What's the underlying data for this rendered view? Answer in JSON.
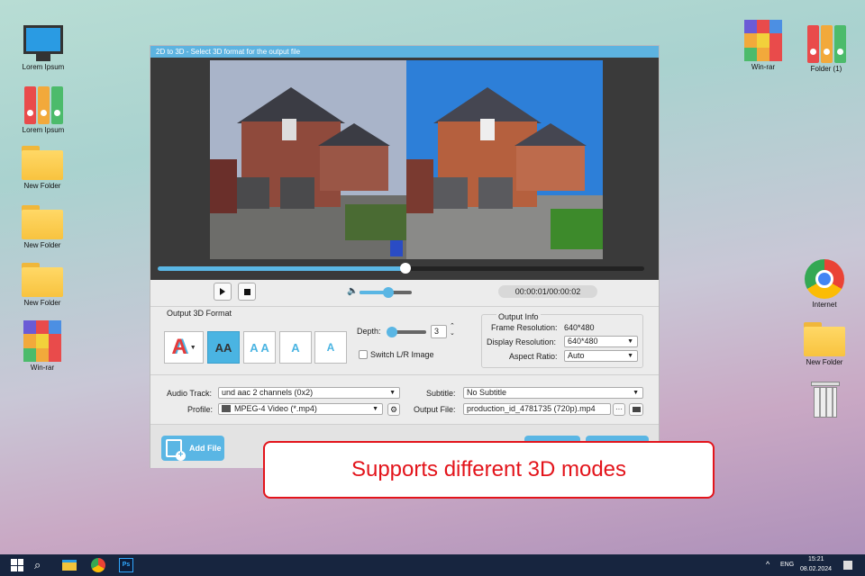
{
  "desktop_left": [
    {
      "label": "Lorem Ipsum",
      "icon": "computer-icon"
    },
    {
      "label": "Lorem Ipsum",
      "icon": "binders-icon"
    },
    {
      "label": "New Folder",
      "icon": "folder-icon"
    },
    {
      "label": "New Folder",
      "icon": "folder-icon"
    },
    {
      "label": "New Folder",
      "icon": "folder-icon"
    },
    {
      "label": "Win-rar",
      "icon": "winrar-icon"
    }
  ],
  "desktop_right": [
    {
      "label": "Win-rar"
    },
    {
      "label": "Folder (1)"
    },
    {
      "label": "Internet"
    },
    {
      "label": "New Folder"
    }
  ],
  "window": {
    "title": "2D to 3D - Select 3D format for the output file"
  },
  "player": {
    "progress": 0.51,
    "volume": 0.55,
    "time": "00:00:01/00:00:02"
  },
  "format": {
    "heading": "Output 3D Format",
    "depth_label": "Depth:",
    "depth_value": "3",
    "switch_label": "Switch L/R Image",
    "modes": [
      "AA",
      "A A",
      "A",
      "A"
    ]
  },
  "output_info": {
    "heading": "Output Info",
    "frame_label": "Frame Resolution:",
    "frame_value": "640*480",
    "display_label": "Display Resolution:",
    "display_value": "640*480",
    "aspect_label": "Aspect Ratio:",
    "aspect_value": "Auto"
  },
  "settings": {
    "audio_label": "Audio Track:",
    "audio_value": "und aac 2 channels (0x2)",
    "subtitle_label": "Subtitle:",
    "subtitle_value": "No Subtitle",
    "profile_label": "Profile:",
    "profile_value": "MPEG-4 Video (*.mp4)",
    "output_label": "Output File:",
    "output_value": "production_id_4781735 (720p).mp4",
    "browse": "···"
  },
  "add_file": "Add File",
  "callout": "Supports different 3D modes",
  "taskbar": {
    "lang": "ENG",
    "time": "15:21",
    "date": "08.02.2024"
  },
  "colors": {
    "accent": "#5ab6e4",
    "callout": "#e3141b",
    "taskbar": "#17253f"
  }
}
